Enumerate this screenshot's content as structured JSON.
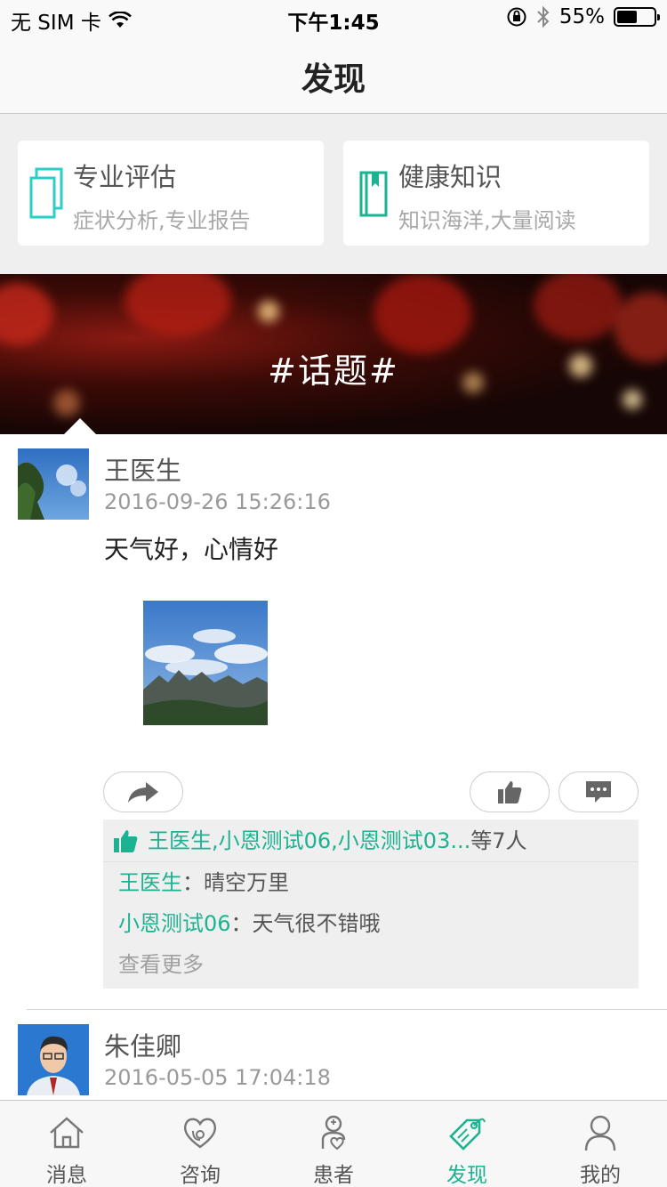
{
  "status_bar": {
    "carrier": "无 SIM 卡",
    "time": "下午1:45",
    "battery": "55%",
    "battery_level": 0.55
  },
  "nav": {
    "title": "发现"
  },
  "cards": [
    {
      "title": "专业评估",
      "subtitle": "症状分析,专业报告",
      "icon": "documents-icon"
    },
    {
      "title": "健康知识",
      "subtitle": "知识海洋,大量阅读",
      "icon": "book-icon"
    }
  ],
  "banner": {
    "title": "#话题#"
  },
  "posts": [
    {
      "author": "王医生",
      "time": "2016-09-26 15:26:16",
      "text": "天气好，心情好",
      "likes": {
        "names": "王医生,小恩测试06,小恩测试03...",
        "count_text": "等7人"
      },
      "comments": [
        {
          "name": "王医生",
          "text": "晴空万里"
        },
        {
          "name": "小恩测试06",
          "text": "天气很不错哦"
        }
      ],
      "more": "查看更多"
    },
    {
      "author": "朱佳卿",
      "time": "2016-05-05 17:04:18"
    }
  ],
  "tabbar": {
    "tabs": [
      {
        "label": "消息",
        "icon": "home-icon"
      },
      {
        "label": "咨询",
        "icon": "consult-heart-icon"
      },
      {
        "label": "患者",
        "icon": "patient-icon"
      },
      {
        "label": "发现",
        "icon": "discover-tag-icon",
        "active": true
      },
      {
        "label": "我的",
        "icon": "profile-icon"
      }
    ]
  },
  "colors": {
    "accent": "#1bb391",
    "card_icon": "#2ccfc7"
  }
}
